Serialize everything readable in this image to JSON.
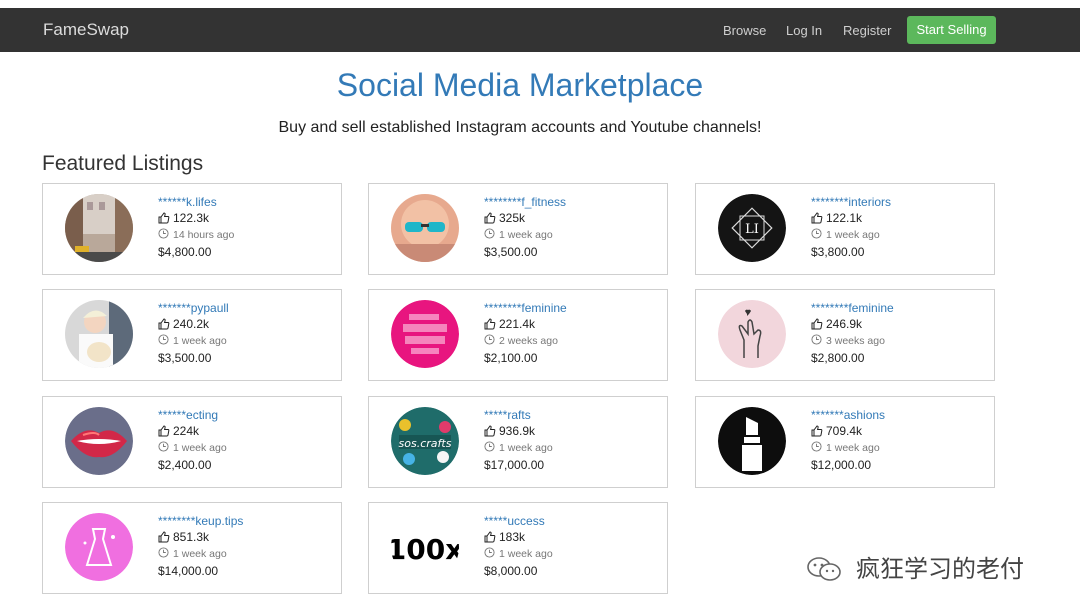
{
  "nav": {
    "brand": "FameSwap",
    "browse": "Browse",
    "login": "Log In",
    "register": "Register",
    "start_selling": "Start Selling"
  },
  "header": {
    "title": "Social Media Marketplace",
    "subtitle": "Buy and sell established Instagram accounts and Youtube channels!"
  },
  "section_title": "Featured Listings",
  "listings": [
    {
      "handle": "******k.lifes",
      "likes": "122.3k",
      "time": "14 hours ago",
      "price": "$4,800.00",
      "avatar": "city-street-photo"
    },
    {
      "handle": "********f_fitness",
      "likes": "325k",
      "time": "1 week ago",
      "price": "$3,500.00",
      "avatar": "sunglasses-selfie-photo"
    },
    {
      "handle": "********interiors",
      "likes": "122.1k",
      "time": "1 week ago",
      "price": "$3,800.00",
      "avatar": "li-logo"
    },
    {
      "handle": "*******pypaull",
      "likes": "240.2k",
      "time": "1 week ago",
      "price": "$3,500.00",
      "avatar": "person-with-dog-photo"
    },
    {
      "handle": "********feminine",
      "likes": "221.4k",
      "time": "2 weeks ago",
      "price": "$2,100.00",
      "avatar": "pink-text-logo"
    },
    {
      "handle": "********feminine",
      "likes": "246.9k",
      "time": "3 weeks ago",
      "price": "$2,800.00",
      "avatar": "hand-heart-drawing"
    },
    {
      "handle": "******ecting",
      "likes": "224k",
      "time": "1 week ago",
      "price": "$2,400.00",
      "avatar": "lips-photo"
    },
    {
      "handle": "*****rafts",
      "likes": "936.9k",
      "time": "1 week ago",
      "price": "$17,000.00",
      "avatar": "crafts-logo"
    },
    {
      "handle": "*******ashions",
      "likes": "709.4k",
      "time": "1 week ago",
      "price": "$12,000.00",
      "avatar": "lipstick-logo"
    },
    {
      "handle": "********keup.tips",
      "likes": "851.3k",
      "time": "1 week ago",
      "price": "$14,000.00",
      "avatar": "dress-logo"
    },
    {
      "handle": "*****uccess",
      "likes": "183k",
      "time": "1 week ago",
      "price": "$8,000.00",
      "avatar": "100x-logo"
    }
  ],
  "avatar_texts": {
    "li": "LI",
    "crafts": "sos.crafts",
    "x100": "100x"
  },
  "watermark": "疯狂学习的老付",
  "colors": {
    "navbar": "#333333",
    "accent": "#337ab7",
    "success": "#5cb85c"
  }
}
